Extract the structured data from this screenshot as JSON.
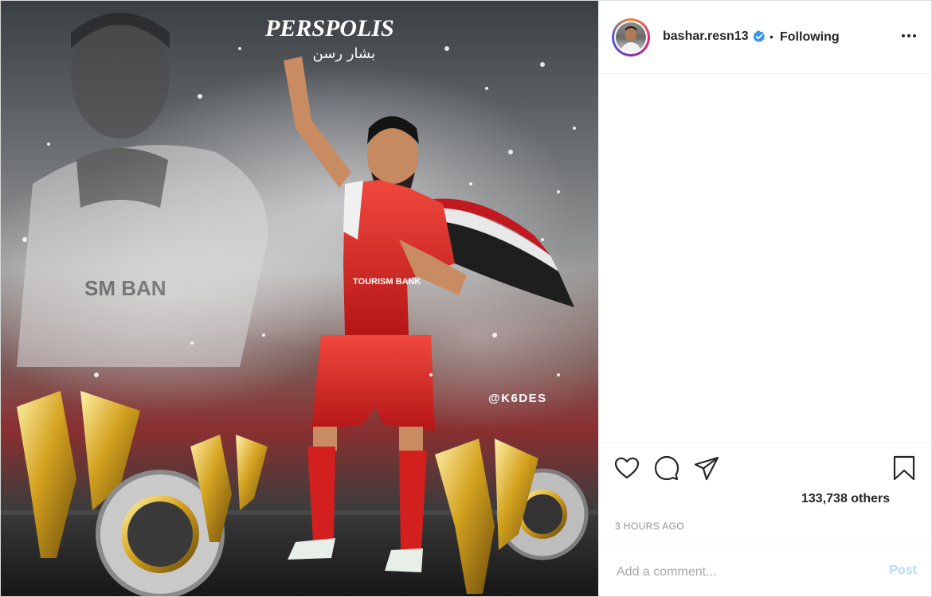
{
  "post": {
    "image_alt": "Persepolis football player poster",
    "image_texts": {
      "brand": "PERSPOLIS",
      "arabic_name": "بشار رسن",
      "watermark": "@K6DES",
      "shirt_sponsor": "TOURISM BANK",
      "shirt_sponsor_ghost": "SM BAN"
    }
  },
  "header": {
    "username": "bashar.resn13",
    "separator": "•",
    "follow_state": "Following",
    "verified_icon": "verified-badge-icon",
    "more_icon": "more-options-icon"
  },
  "actions": {
    "like_icon": "heart-icon",
    "comment_icon": "comment-icon",
    "share_icon": "share-icon",
    "save_icon": "bookmark-icon"
  },
  "likes_text": "133,738 others",
  "timestamp": "3 HOURS AGO",
  "comment_box": {
    "placeholder": "Add a comment...",
    "post_label": "Post"
  },
  "colors": {
    "verified_blue": "#3897f0",
    "post_disabled": "#b3dbff",
    "jersey_red": "#e02424",
    "trophy_gold": "#d4a21f"
  }
}
